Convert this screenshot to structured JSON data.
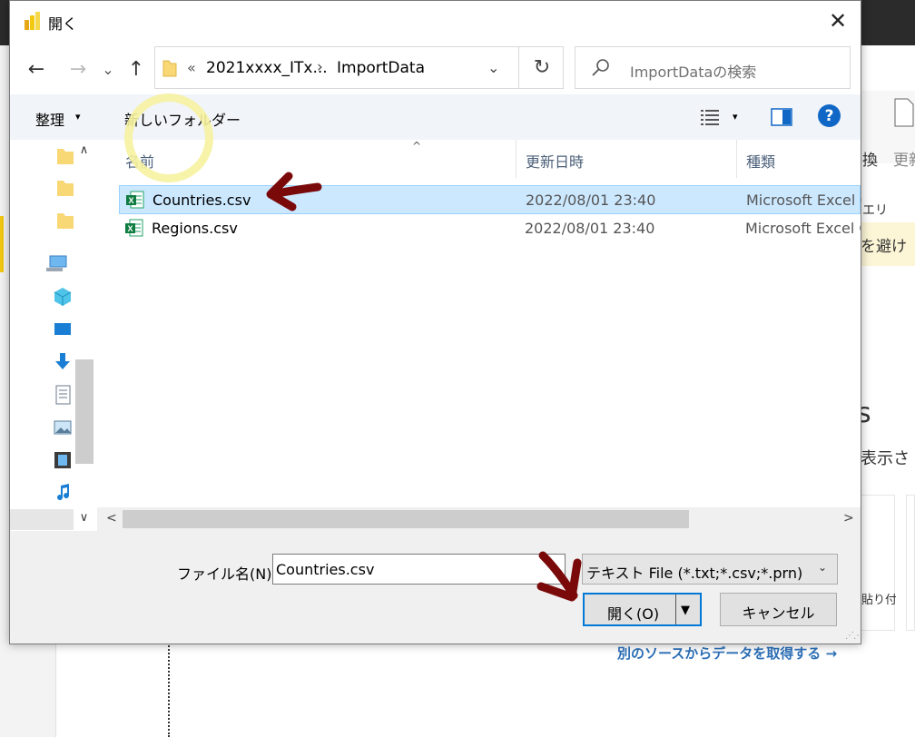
{
  "background": {
    "ribbon_text1": "換",
    "ribbon_text2": "更新",
    "sidebar_text": "エリ",
    "banner_text": "を避け",
    "heading_fragment": "s",
    "body_text": "表示さ",
    "card_text": "貼り付",
    "link_text": "別のソースからデータを取得する →"
  },
  "dialog": {
    "title": "開く",
    "close_glyph": "✕"
  },
  "nav": {
    "back": "←",
    "forward": "→",
    "recent": "⌄",
    "up": "↑"
  },
  "address": {
    "overflow": "«",
    "segments": [
      "2021xxxx_ITx...",
      "ImportData"
    ],
    "separator": "›",
    "dropdown": "⌄",
    "refresh": "↻"
  },
  "search": {
    "placeholder": "ImportDataの検索"
  },
  "toolbar": {
    "organize": "整理",
    "caret": "▾",
    "new_folder": "新しいフォルダー",
    "help": "?"
  },
  "columns": {
    "sort_indicator": "^",
    "name": "名前",
    "date": "更新日時",
    "type": "種類"
  },
  "files": [
    {
      "name": "Countries.csv",
      "date": "2022/08/01 23:40",
      "type": "Microsoft Excel C",
      "selected": true
    },
    {
      "name": "Regions.csv",
      "date": "2022/08/01 23:40",
      "type": "Microsoft Excel C",
      "selected": false
    }
  ],
  "scroll": {
    "up": "∧",
    "down": "∨",
    "left": "<",
    "right": ">"
  },
  "bottom": {
    "filename_label": "ファイル名(N):",
    "filename_value": "Countries.csv",
    "filter_value": "テキスト File (*.txt;*.csv;*.prn)",
    "filter_caret": "⌄",
    "open_label": "開く(O)",
    "open_caret": "▼",
    "cancel_label": "キャンセル",
    "grip": "⋰⋰"
  },
  "colors": {
    "accent": "#0078d7",
    "selection": "#cce8ff",
    "annotation_arrow": "#7a0a0a",
    "annotation_circle": "#f6f2a0",
    "brand": "#f2c811"
  },
  "annotations": [
    "arrow pointing to Countries.csv",
    "arrow pointing to Open button",
    "highlight circle on new folder"
  ]
}
